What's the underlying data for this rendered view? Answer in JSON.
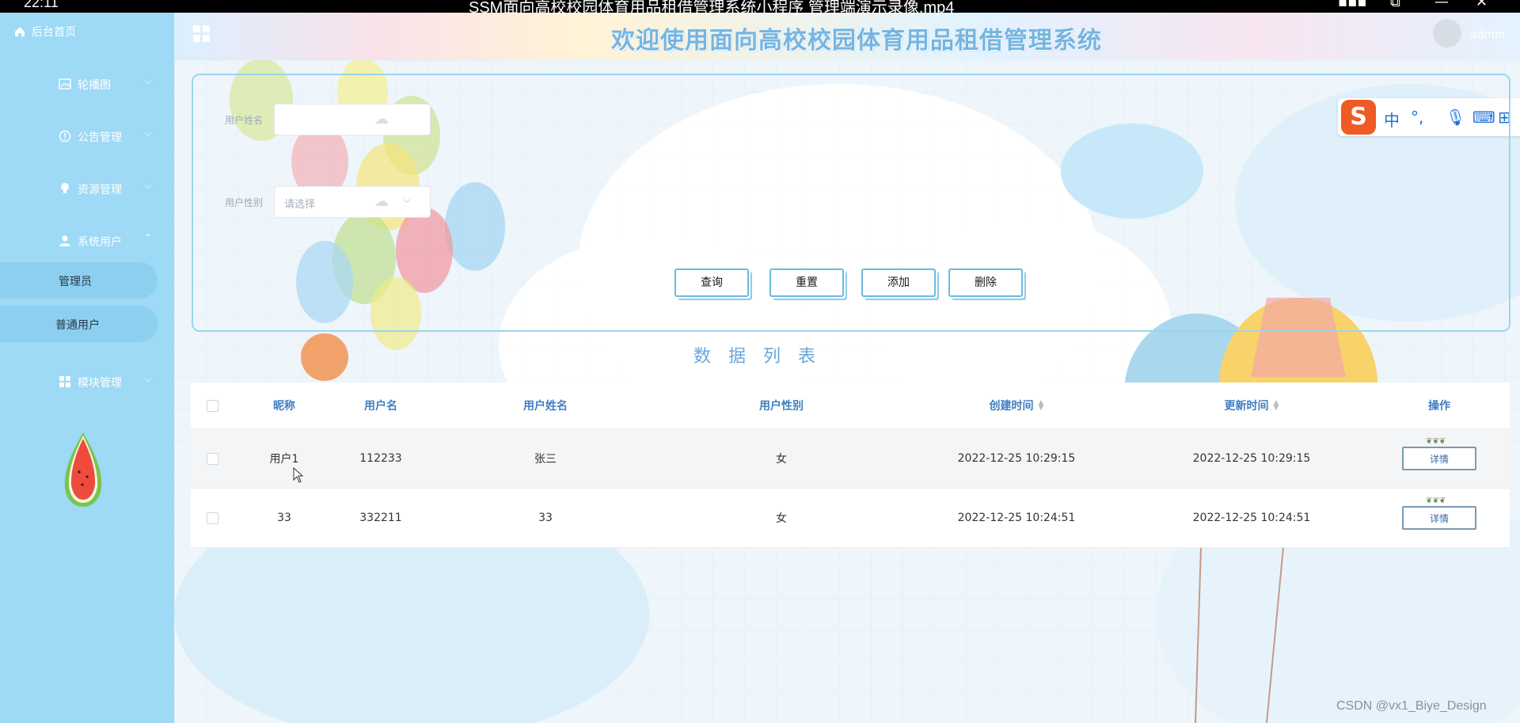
{
  "video": {
    "time": "22:11",
    "title": "SSM面向高校校园体育用品租借管理系统小程序 管理端演示录像.mp4"
  },
  "sidebar": {
    "home_label": "后台首页",
    "items": [
      {
        "label": "轮播图",
        "icon": "image-icon",
        "expanded": false
      },
      {
        "label": "公告管理",
        "icon": "info-icon",
        "expanded": false
      },
      {
        "label": "资源管理",
        "icon": "bulb-icon",
        "expanded": false
      },
      {
        "label": "系统用户",
        "icon": "user-icon",
        "expanded": true
      },
      {
        "label": "模块管理",
        "icon": "grid-icon",
        "expanded": false
      }
    ],
    "subitems": [
      {
        "label": "管理员"
      },
      {
        "label": "普通用户"
      }
    ]
  },
  "header": {
    "title": "欢迎使用面向高校校园体育用品租借管理系统",
    "user": "admin"
  },
  "search": {
    "name_label": "用户姓名",
    "name_value": "",
    "gender_label": "用户性别",
    "gender_placeholder": "请选择",
    "buttons": {
      "query": "查询",
      "reset": "重置",
      "add": "添加",
      "delete": "删除"
    }
  },
  "list_title": "数据列表",
  "table": {
    "headers": [
      "昵称",
      "用户名",
      "用户姓名",
      "用户性别",
      "创建时间",
      "更新时间",
      "操作"
    ],
    "rows": [
      {
        "nickname": "用户1",
        "username": "112233",
        "realname": "张三",
        "gender": "女",
        "created": "2022-12-25 10:29:15",
        "updated": "2022-12-25 10:29:15",
        "action": "详情"
      },
      {
        "nickname": "33",
        "username": "332211",
        "realname": "33",
        "gender": "女",
        "created": "2022-12-25 10:24:51",
        "updated": "2022-12-25 10:24:51",
        "action": "详情"
      }
    ]
  },
  "ime": {
    "items": [
      "中",
      "°,"
    ]
  },
  "watermark": "CSDN @vx1_Biye_Design",
  "colors": {
    "sidebar": "#9ed9f5",
    "accent": "#6bbbe0",
    "header_text": "#3f7fc1"
  }
}
